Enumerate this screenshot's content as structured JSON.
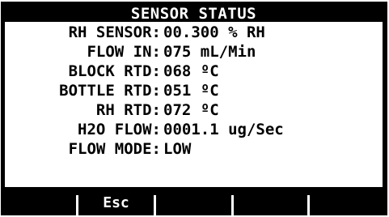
{
  "title": "SENSOR STATUS",
  "rows": [
    {
      "label": "RH SENSOR:",
      "value": "00.300 % RH"
    },
    {
      "label": "FLOW IN:",
      "value": "075 mL/Min"
    },
    {
      "label": "BLOCK RTD:",
      "value": "068 ºC"
    },
    {
      "label": "BOTTLE RTD:",
      "value": "051 ºC"
    },
    {
      "label": "RH RTD:",
      "value": "072 ºC"
    },
    {
      "label": "H2O FLOW:",
      "value": "0001.1 ug/Sec"
    },
    {
      "label": "FLOW MODE:",
      "value": "LOW"
    }
  ],
  "softkeys": [
    "",
    "Esc",
    "",
    "",
    ""
  ]
}
